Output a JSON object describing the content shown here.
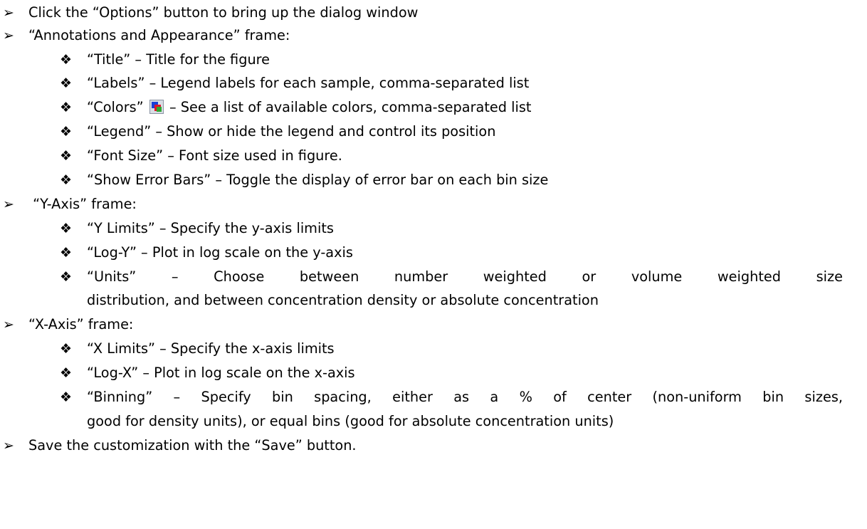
{
  "bullets": {
    "level1": "➢",
    "level2": "❖"
  },
  "items": [
    {
      "level": 1,
      "text": "Click the “Options” button to bring up the dialog window"
    },
    {
      "level": 1,
      "text": "“Annotations and Appearance” frame:"
    },
    {
      "level": 2,
      "text": "“Title” – Title for the figure"
    },
    {
      "level": 2,
      "text": "“Labels” – Legend labels for each sample, comma-separated list"
    },
    {
      "level": 2,
      "text_before": "“Colors”",
      "icon": "colors-palette-icon",
      "text_after": "– See a list of available colors, comma-separated list"
    },
    {
      "level": 2,
      "text": "“Legend” – Show or hide the legend and control its position"
    },
    {
      "level": 2,
      "text": "“Font Size” – Font size used in figure."
    },
    {
      "level": 2,
      "text": "“Show Error Bars” – Toggle the display of error bar on each bin size"
    },
    {
      "level": 1,
      "text": " “Y-Axis” frame:"
    },
    {
      "level": 2,
      "text": "“Y Limits” – Specify the y-axis limits"
    },
    {
      "level": 2,
      "text": "“Log-Y” – Plot in log scale on the y-axis"
    },
    {
      "level": 2,
      "text": "“Units” – Choose between number weighted or volume weighted size",
      "continuation": "distribution, and between concentration density or absolute concentration"
    },
    {
      "level": 1,
      "text": "“X-Axis” frame:"
    },
    {
      "level": 2,
      "text": "“X Limits” – Specify the x-axis limits"
    },
    {
      "level": 2,
      "text": "“Log-X” – Plot in log scale on the x-axis"
    },
    {
      "level": 2,
      "text": "“Binning” – Specify bin spacing, either as a % of center (non-uniform bin sizes,",
      "continuation": "good for density units), or equal bins (good for absolute concentration units)"
    },
    {
      "level": 1,
      "text": "Save the customization with the “Save” button."
    }
  ]
}
